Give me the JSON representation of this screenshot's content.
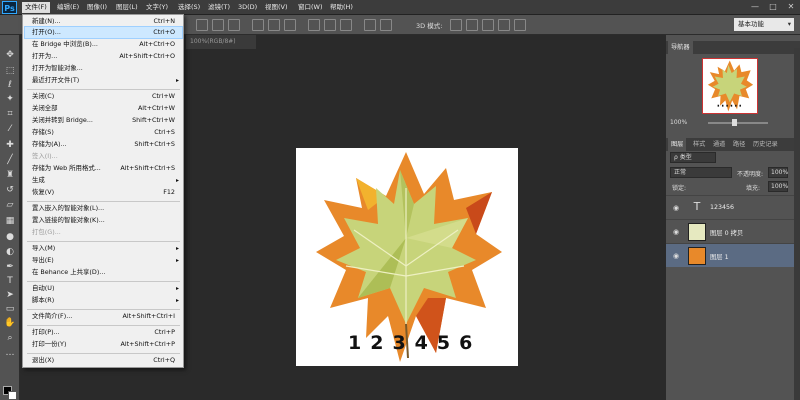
{
  "menubar": {
    "logo": "Ps",
    "items": [
      "文件(F)",
      "编辑(E)",
      "图像(I)",
      "图层(L)",
      "文字(Y)",
      "选择(S)",
      "滤镜(T)",
      "3D(D)",
      "视图(V)",
      "窗口(W)",
      "帮助(H)"
    ],
    "window_controls": [
      "—",
      "□",
      "✕"
    ]
  },
  "options_bar": {
    "mode_3d_label": "3D 模式:",
    "workspace": "基本功能"
  },
  "document": {
    "tab_title": "100%(RGB/8#)"
  },
  "canvas": {
    "numbers": "123456"
  },
  "file_menu": {
    "items": [
      {
        "label": "新建(N)...",
        "shortcut": "Ctrl+N"
      },
      {
        "label": "打开(O)...",
        "shortcut": "Ctrl+O",
        "highlighted": true
      },
      {
        "label": "在 Bridge 中浏览(B)...",
        "shortcut": "Alt+Ctrl+O"
      },
      {
        "label": "打开为...",
        "shortcut": "Alt+Shift+Ctrl+O"
      },
      {
        "label": "打开为智能对象...",
        "shortcut": ""
      },
      {
        "label": "最近打开文件(T)",
        "shortcut": "",
        "submenu": true
      },
      {
        "label": "关闭(C)",
        "shortcut": "Ctrl+W"
      },
      {
        "label": "关闭全部",
        "shortcut": "Alt+Ctrl+W"
      },
      {
        "label": "关闭并转到 Bridge...",
        "shortcut": "Shift+Ctrl+W"
      },
      {
        "label": "存储(S)",
        "shortcut": "Ctrl+S"
      },
      {
        "label": "存储为(A)...",
        "shortcut": "Shift+Ctrl+S"
      },
      {
        "label": "签入(I)...",
        "shortcut": "",
        "disabled": true
      },
      {
        "label": "存储为 Web 所用格式...",
        "shortcut": "Alt+Shift+Ctrl+S"
      },
      {
        "label": "生成",
        "shortcut": "",
        "submenu": true
      },
      {
        "label": "恢复(V)",
        "shortcut": "F12"
      },
      {
        "label": "置入嵌入的智能对象(L)...",
        "shortcut": ""
      },
      {
        "label": "置入链接的智能对象(K)...",
        "shortcut": ""
      },
      {
        "label": "打包(G)...",
        "shortcut": "",
        "disabled": true
      },
      {
        "label": "导入(M)",
        "shortcut": "",
        "submenu": true
      },
      {
        "label": "导出(E)",
        "shortcut": "",
        "submenu": true
      },
      {
        "label": "在 Behance 上共享(D)...",
        "shortcut": ""
      },
      {
        "label": "自动(U)",
        "shortcut": "",
        "submenu": true
      },
      {
        "label": "脚本(R)",
        "shortcut": "",
        "submenu": true
      },
      {
        "label": "文件简介(F)...",
        "shortcut": "Alt+Shift+Ctrl+I"
      },
      {
        "label": "打印(P)...",
        "shortcut": "Ctrl+P"
      },
      {
        "label": "打印一份(Y)",
        "shortcut": "Alt+Shift+Ctrl+P"
      },
      {
        "label": "退出(X)",
        "shortcut": "Ctrl+Q"
      }
    ]
  },
  "navigator": {
    "tab": "导航器",
    "zoom": "100%"
  },
  "layers_panel": {
    "tabs": [
      "图层",
      "样式",
      "通道",
      "路径",
      "历史记录"
    ],
    "kind_filter": "ρ 类型",
    "blend_mode": "正常",
    "opacity_label": "不透明度:",
    "opacity": "100%",
    "lock_label": "锁定:",
    "fill_label": "填充:",
    "fill": "100%",
    "layers": [
      {
        "name": "123456",
        "type": "text"
      },
      {
        "name": "图层 0 拷贝",
        "type": "image"
      },
      {
        "name": "图层 1",
        "type": "image",
        "selected": true
      }
    ]
  },
  "colors": {
    "accent": "#31a8ff",
    "menu_highlight": "#cde8ff",
    "layer_selected": "#5b6b83"
  }
}
